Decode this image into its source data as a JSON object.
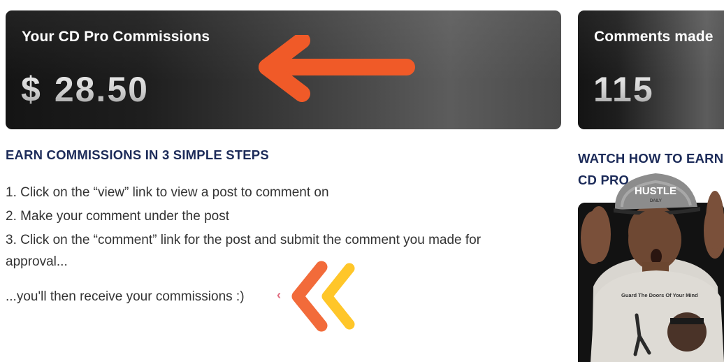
{
  "commissions_card": {
    "title": "Your CD Pro Commissions",
    "currency": "$",
    "amount": "28.50"
  },
  "comments_card": {
    "title": "Comments made",
    "count": "115"
  },
  "steps": {
    "heading": "EARN COMMISSIONS IN 3 SIMPLE STEPS",
    "items": [
      "1. Click on the “view” link to view a post to comment on",
      "2. Make your comment under the post",
      "3. Click on the “comment” link for the post and submit the comment you made for approval..."
    ],
    "closing": "...you'll then receive your commissions :)"
  },
  "watch": {
    "heading": "WATCH HOW TO EARN CD PRO"
  },
  "video_shirt_text": "Guard The Doors Of Your Mind",
  "video_cap_text": "HUSTLE",
  "video_cap_small": "DAILY",
  "colors": {
    "heading": "#1c2b59",
    "arrow_orange": "#f05a28",
    "chevron_orange": "#f26b3a",
    "chevron_yellow": "#ffc629"
  }
}
